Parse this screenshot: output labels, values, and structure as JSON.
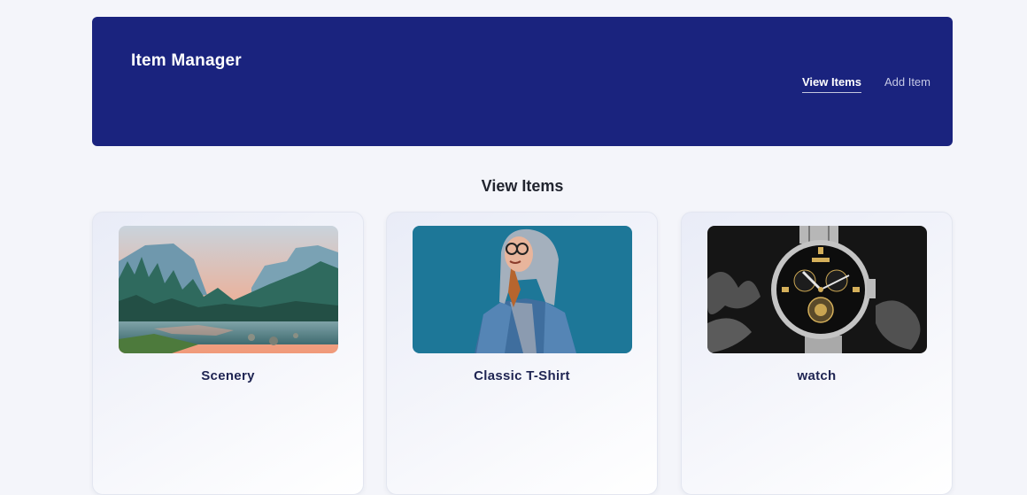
{
  "header": {
    "brand": "Item Manager",
    "nav": [
      {
        "label": "View Items",
        "active": true
      },
      {
        "label": "Add Item",
        "active": false
      }
    ],
    "color": "#1a237e"
  },
  "main": {
    "title": "View Items",
    "items": [
      {
        "name": "Scenery",
        "image": "mountain-lake-landscape"
      },
      {
        "name": "Classic T-Shirt",
        "image": "person-in-denim-jacket"
      },
      {
        "name": "watch",
        "image": "black-wristwatch"
      }
    ]
  }
}
